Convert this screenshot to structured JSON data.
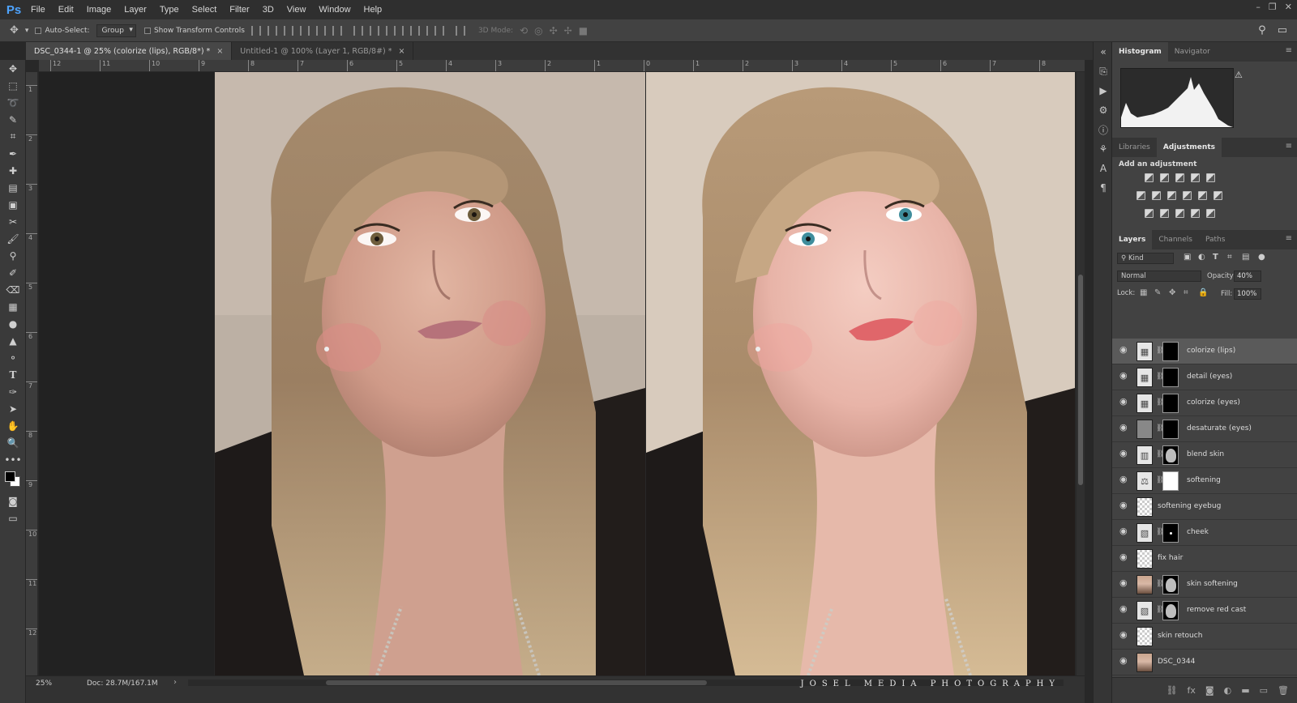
{
  "app": {
    "logo": "Ps",
    "menu": [
      "File",
      "Edit",
      "Image",
      "Layer",
      "Type",
      "Select",
      "Filter",
      "3D",
      "View",
      "Window",
      "Help"
    ]
  },
  "options": {
    "auto_select_label": "Auto-Select:",
    "auto_select_mode": "Group",
    "transform_label": "Show Transform Controls",
    "three_d_mode_label": "3D Mode:"
  },
  "tabs": [
    {
      "label": "DSC_0344-1 @ 25% (colorize (lips), RGB/8*) *",
      "active": true
    },
    {
      "label": "Untitled-1 @ 100% (Layer 1, RGB/8#) *",
      "active": false
    }
  ],
  "ruler_top": [
    "12",
    "11",
    "10",
    "9",
    "8",
    "7",
    "6",
    "5",
    "4",
    "3",
    "2",
    "1",
    "0",
    "1",
    "2",
    "3",
    "4",
    "5",
    "6",
    "7",
    "8"
  ],
  "ruler_left": [
    "1",
    "2",
    "3",
    "4",
    "5",
    "6",
    "7",
    "8",
    "9",
    "10",
    "11",
    "12"
  ],
  "status": {
    "zoom": "25%",
    "doc_size": "Doc: 28.7M/167.1M",
    "watermark": "JOSEL MEDIA PHOTOGRAPHY"
  },
  "panels": {
    "histogram_tab": "Histogram",
    "navigator_tab": "Navigator",
    "libraries_tab": "Libraries",
    "adjustments_tab": "Adjustments",
    "add_adjustment": "Add an adjustment",
    "layers_tab": "Layers",
    "channels_tab": "Channels",
    "paths_tab": "Paths",
    "kind_filter": "Kind",
    "blend_mode": "Normal",
    "opacity_label": "Opacity:",
    "opacity": "40%",
    "lock_label": "Lock:",
    "fill_label": "Fill:",
    "fill": "100%"
  },
  "layers": [
    {
      "name": "colorize (lips)",
      "thumb": "adj",
      "glyph": "▦",
      "mask": "black",
      "selected": true
    },
    {
      "name": "detail (eyes)",
      "thumb": "adj",
      "glyph": "▦",
      "mask": "black",
      "selected": false
    },
    {
      "name": "colorize (eyes)",
      "thumb": "adj",
      "glyph": "▦",
      "mask": "black",
      "selected": false
    },
    {
      "name": "desaturate (eyes)",
      "thumb": "gray",
      "glyph": "",
      "mask": "black",
      "selected": false
    },
    {
      "name": "blend skin",
      "thumb": "adj",
      "glyph": "▥",
      "mask": "face",
      "selected": false
    },
    {
      "name": "softening",
      "thumb": "adj",
      "glyph": "⚖",
      "mask": "white",
      "selected": false
    },
    {
      "name": "softening eyebug",
      "thumb": "checker",
      "glyph": "",
      "mask": "none",
      "selected": false
    },
    {
      "name": "cheek",
      "thumb": "adj",
      "glyph": "▧",
      "mask": "dot",
      "selected": false
    },
    {
      "name": "fix hair",
      "thumb": "checker",
      "glyph": "",
      "mask": "none",
      "selected": false
    },
    {
      "name": "skin softening",
      "thumb": "photo",
      "glyph": "",
      "mask": "face",
      "selected": false
    },
    {
      "name": "remove red cast",
      "thumb": "adj",
      "glyph": "▧",
      "mask": "face",
      "selected": false
    },
    {
      "name": "skin retouch",
      "thumb": "checker",
      "glyph": "",
      "mask": "none",
      "selected": false
    },
    {
      "name": "DSC_0344",
      "thumb": "photo",
      "glyph": "",
      "mask": "none",
      "selected": false
    }
  ]
}
